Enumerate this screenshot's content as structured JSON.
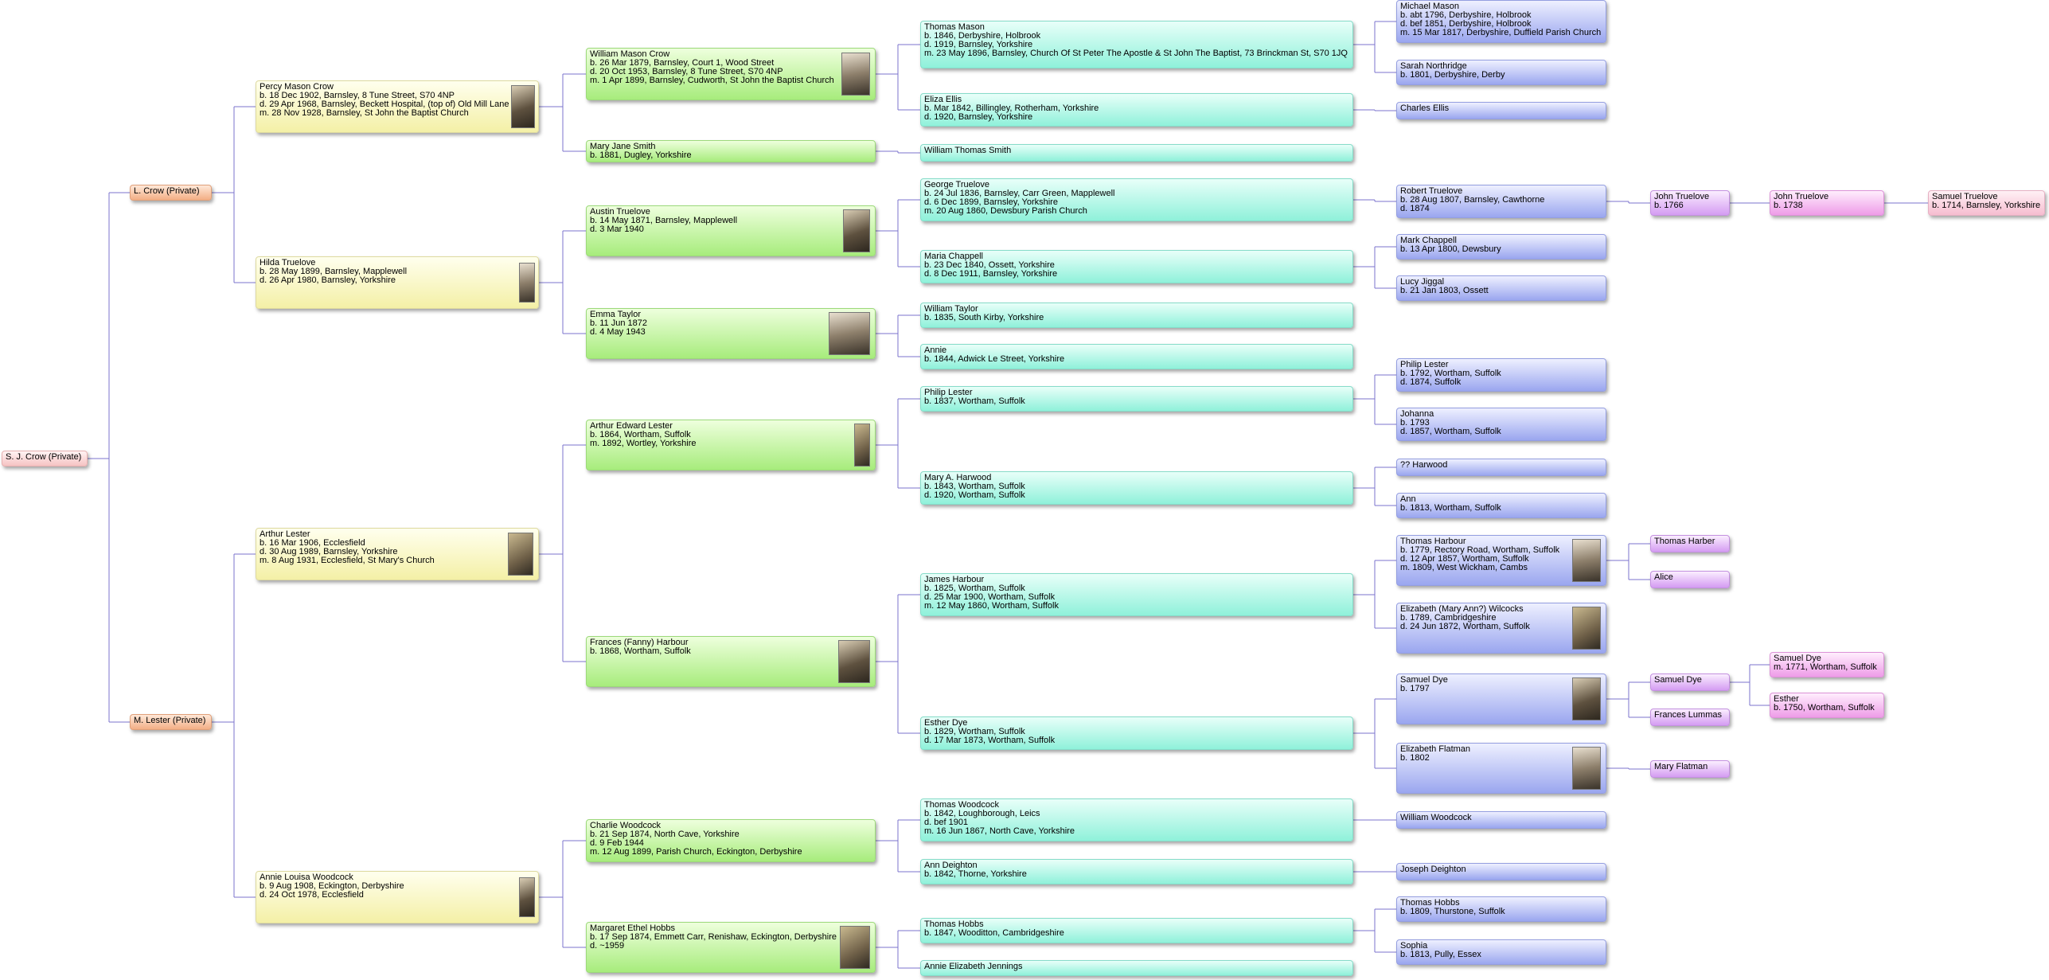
{
  "people": [
    {
      "name": "S. J. Crow (Private)",
      "details": []
    },
    {
      "name": "L. Crow (Private)",
      "details": []
    },
    {
      "name": "M. Lester (Private)",
      "details": []
    },
    {
      "name": "Percy Mason Crow",
      "details": [
        "b. 18 Dec 1902, Barnsley, 8 Tune Street, S70 4NP",
        "d. 29 Apr 1968, Barnsley, Beckett Hospital, (top of) Old Mill Lane",
        "m. 28 Nov 1928, Barnsley, St John the Baptist Church"
      ]
    },
    {
      "name": "Hilda Truelove",
      "details": [
        "b. 28 May 1899, Barnsley, Mapplewell",
        "d. 26 Apr 1980, Barnsley, Yorkshire"
      ]
    },
    {
      "name": "Arthur Lester",
      "details": [
        "b. 16 Mar 1906, Ecclesfield",
        "d. 30 Aug 1989, Barnsley, Yorkshire",
        "m. 8 Aug 1931, Ecclesfield, St Mary's Church"
      ]
    },
    {
      "name": "Annie Louisa Woodcock",
      "details": [
        "b. 9 Aug 1908, Eckington, Derbyshire",
        "d. 24 Oct 1978, Ecclesfield"
      ]
    },
    {
      "name": "William Mason Crow",
      "details": [
        "b. 26 Mar 1879, Barnsley, Court 1, Wood Street",
        "d. 20 Oct 1953, Barnsley, 8 Tune Street, S70 4NP",
        "m. 1 Apr 1899, Barnsley, Cudworth, St John the Baptist Church"
      ]
    },
    {
      "name": "Mary Jane Smith",
      "details": [
        "b. 1881, Dugley, Yorkshire"
      ]
    },
    {
      "name": "Austin Truelove",
      "details": [
        "b. 14 May 1871, Barnsley, Mapplewell",
        "d. 3 Mar 1940"
      ]
    },
    {
      "name": "Emma Taylor",
      "details": [
        "b. 11 Jun 1872",
        "d. 4 May 1943"
      ]
    },
    {
      "name": "Arthur Edward Lester",
      "details": [
        "b. 1864, Wortham, Suffolk",
        "m. 1892, Wortley, Yorkshire"
      ]
    },
    {
      "name": "Frances (Fanny) Harbour",
      "details": [
        "b. 1868, Wortham, Suffolk"
      ]
    },
    {
      "name": "Charlie Woodcock",
      "details": [
        "b. 21 Sep 1874, North Cave, Yorkshire",
        "d. 9 Feb 1944",
        "m. 12 Aug 1899, Parish Church, Eckington, Derbyshire"
      ]
    },
    {
      "name": "Margaret Ethel Hobbs",
      "details": [
        "b. 17 Sep 1874, Emmett Carr, Renishaw, Eckington, Derbyshire",
        "d. ~1959"
      ]
    },
    {
      "name": "Thomas Mason",
      "details": [
        "b. 1846, Derbyshire, Holbrook",
        "d. 1919, Barnsley, Yorkshire",
        "m. 23 May 1896, Barnsley, Church Of St Peter The Apostle & St John The Baptist, 73 Brinckman St, S70 1JQ"
      ]
    },
    {
      "name": "Eliza Ellis",
      "details": [
        "b. Mar 1842, Billingley, Rotherham, Yorkshire",
        "d. 1920, Barnsley, Yorkshire"
      ]
    },
    {
      "name": "William Thomas Smith",
      "details": []
    },
    {
      "name": "George Truelove",
      "details": [
        "b. 24 Jul 1836, Barnsley, Carr Green, Mapplewell",
        "d. 6 Dec 1899, Barnsley, Yorkshire",
        "m. 20 Aug 1860, Dewsbury Parish Church"
      ]
    },
    {
      "name": "Maria Chappell",
      "details": [
        "b. 23 Dec 1840, Ossett, Yorkshire",
        "d. 8 Dec 1911, Barnsley, Yorkshire"
      ]
    },
    {
      "name": "William Taylor",
      "details": [
        "b. 1835, South Kirby, Yorkshire"
      ]
    },
    {
      "name": "Annie",
      "details": [
        "b. 1844, Adwick Le Street, Yorkshire"
      ]
    },
    {
      "name": "Philip Lester",
      "details": [
        "b. 1837, Wortham, Suffolk"
      ]
    },
    {
      "name": "Mary A. Harwood",
      "details": [
        "b. 1843, Wortham, Suffolk",
        "d. 1920, Wortham, Suffolk"
      ]
    },
    {
      "name": "James Harbour",
      "details": [
        "b. 1825, Wortham, Suffolk",
        "d. 25 Mar 1900, Wortham, Suffolk",
        "m. 12 May 1860, Wortham, Suffolk"
      ]
    },
    {
      "name": "Esther Dye",
      "details": [
        "b. 1829, Wortham, Suffolk",
        "d. 17 Mar 1873, Wortham, Suffolk"
      ]
    },
    {
      "name": "Thomas Woodcock",
      "details": [
        "b. 1842, Loughborough, Leics",
        "d. bef 1901",
        "m. 16 Jun 1867, North Cave, Yorkshire"
      ]
    },
    {
      "name": "Ann Deighton",
      "details": [
        "b. 1842, Thorne, Yorkshire"
      ]
    },
    {
      "name": "Thomas Hobbs",
      "details": [
        "b. 1847, Wooditton, Cambridgeshire"
      ]
    },
    {
      "name": "Annie Elizabeth Jennings",
      "details": []
    },
    {
      "name": "Michael Mason",
      "details": [
        "b. abt 1796, Derbyshire, Holbrook",
        "d. bef 1851, Derbyshire, Holbrook",
        "m. 15 Mar 1817, Derbyshire, Duffield Parish Church"
      ]
    },
    {
      "name": "Sarah Northridge",
      "details": [
        "b. 1801, Derbyshire, Derby"
      ]
    },
    {
      "name": "Charles Ellis",
      "details": []
    },
    {
      "name": "Robert Truelove",
      "details": [
        "b. 28 Aug 1807, Barnsley, Cawthorne",
        "d. 1874"
      ]
    },
    {
      "name": "Mark Chappell",
      "details": [
        "b. 13 Apr 1800, Dewsbury"
      ]
    },
    {
      "name": "Lucy Jiggal",
      "details": [
        "b. 21 Jan 1803, Ossett"
      ]
    },
    {
      "name": "Philip Lester",
      "details": [
        "b. 1792, Wortham, Suffolk",
        "d. 1874, Suffolk"
      ]
    },
    {
      "name": "Johanna",
      "details": [
        "b. 1793",
        "d. 1857, Wortham, Suffolk"
      ]
    },
    {
      "name": "?? Harwood",
      "details": []
    },
    {
      "name": "Ann",
      "details": [
        "b. 1813, Wortham, Suffolk"
      ]
    },
    {
      "name": "Thomas Harbour",
      "details": [
        "b. 1779, Rectory Road, Wortham, Suffolk",
        "d. 12 Apr 1857, Wortham, Suffolk",
        "m. 1809, West Wickham, Cambs"
      ]
    },
    {
      "name": "Elizabeth (Mary Ann?) Wilcocks",
      "details": [
        "b. 1789, Cambridgeshire",
        "d. 24 Jun 1872, Wortham, Suffolk"
      ]
    },
    {
      "name": "Samuel Dye",
      "details": [
        "b. 1797"
      ]
    },
    {
      "name": "Elizabeth Flatman",
      "details": [
        "b. 1802"
      ]
    },
    {
      "name": "William Woodcock",
      "details": []
    },
    {
      "name": "Joseph Deighton",
      "details": []
    },
    {
      "name": "Thomas Hobbs",
      "details": [
        "b. 1809, Thurstone, Suffolk"
      ]
    },
    {
      "name": "Sophia",
      "details": [
        "b. 1813, Pully, Essex"
      ]
    },
    {
      "name": "John Truelove",
      "details": [
        "b. 1766"
      ]
    },
    {
      "name": "Thomas Harber",
      "details": []
    },
    {
      "name": "Alice",
      "details": []
    },
    {
      "name": "Samuel Dye",
      "details": []
    },
    {
      "name": "Frances Lummas",
      "details": []
    },
    {
      "name": "Mary Flatman",
      "details": []
    },
    {
      "name": "John Truelove",
      "details": [
        "b. 1738"
      ]
    },
    {
      "name": "Samuel Dye",
      "details": [
        "m. 1771, Wortham, Suffolk"
      ]
    },
    {
      "name": "Esther",
      "details": [
        "b. 1750, Wortham, Suffolk"
      ]
    },
    {
      "name": "Samuel Truelove",
      "details": [
        "b. 1714, Barnsley, Yorkshire"
      ]
    }
  ],
  "colors": {
    "line": "#7b73cc"
  }
}
